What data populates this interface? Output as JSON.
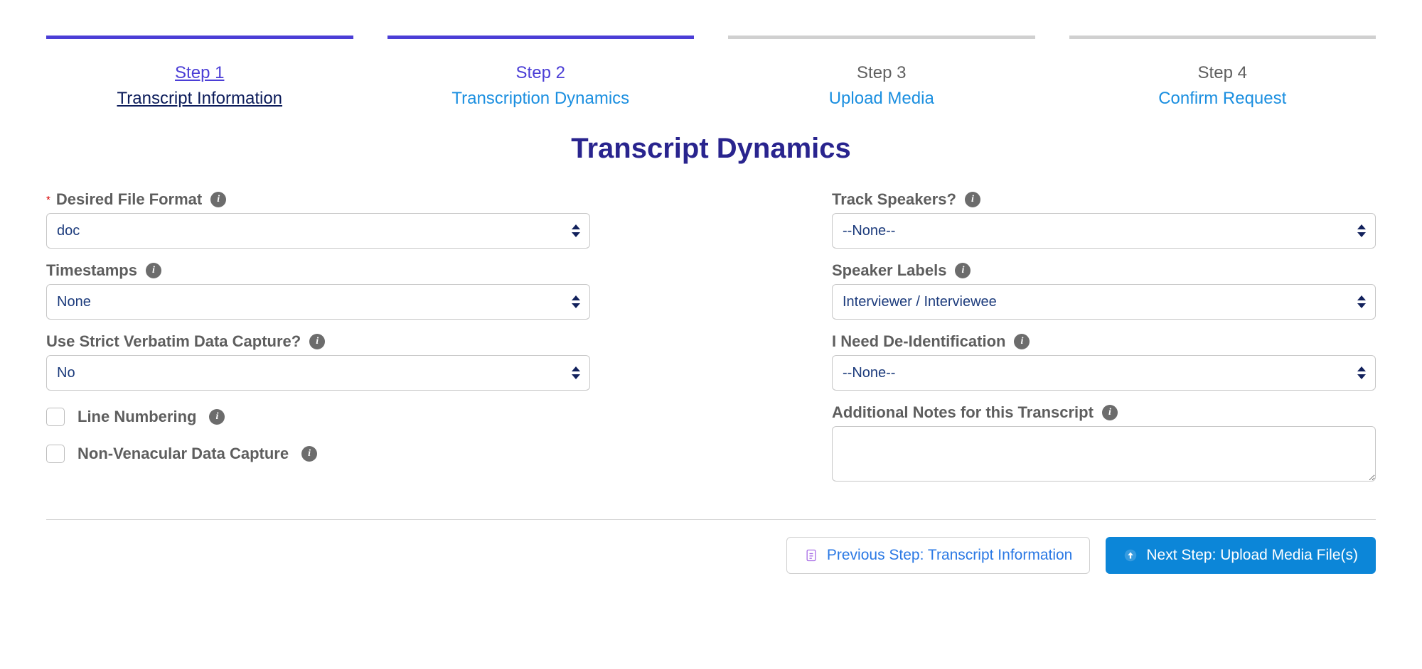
{
  "stepper": [
    {
      "num": "Step 1",
      "title": "Transcript Information",
      "state": "active"
    },
    {
      "num": "Step 2",
      "title": "Transcription Dynamics",
      "state": "current"
    },
    {
      "num": "Step 3",
      "title": "Upload Media",
      "state": "idle"
    },
    {
      "num": "Step 4",
      "title": "Confirm Request",
      "state": "idle"
    }
  ],
  "page_title": "Transcript Dynamics",
  "left": {
    "file_format": {
      "label": "Desired File Format",
      "value": "doc",
      "required": true
    },
    "timestamps": {
      "label": "Timestamps",
      "value": "None"
    },
    "verbatim": {
      "label": "Use Strict Verbatim Data Capture?",
      "value": "No"
    },
    "line_numbering": {
      "label": "Line Numbering",
      "checked": false
    },
    "non_vernacular": {
      "label": "Non-Venacular Data Capture",
      "checked": false
    }
  },
  "right": {
    "track_speakers": {
      "label": "Track Speakers?",
      "value": "--None--"
    },
    "speaker_labels": {
      "label": "Speaker Labels",
      "value": "Interviewer / Interviewee"
    },
    "deident": {
      "label": "I Need De-Identification",
      "value": "--None--"
    },
    "notes": {
      "label": "Additional Notes for this Transcript",
      "value": ""
    }
  },
  "footer": {
    "prev": "Previous Step: Transcript Information",
    "next": "Next Step: Upload Media File(s)"
  }
}
